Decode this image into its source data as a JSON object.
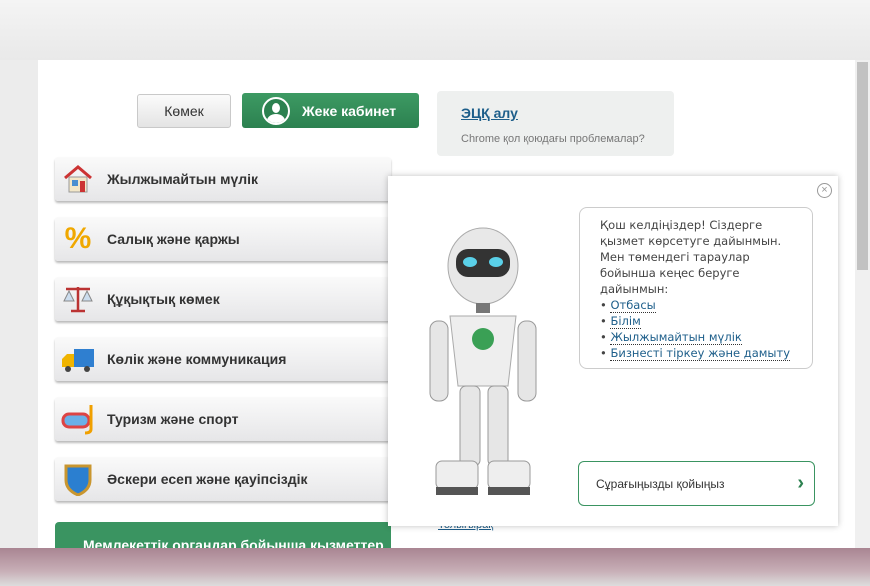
{
  "header": {
    "help_label": "Көмек",
    "cabinet_label": "Жеке кабинет"
  },
  "ecp": {
    "link": "ЭЦҚ алу",
    "subtitle": "Chrome қол қоюдағы проблемалар?"
  },
  "menu": [
    {
      "label": "Жылжымайтын мүлік",
      "icon": "house-icon"
    },
    {
      "label": "Салық және қаржы",
      "icon": "percent-icon"
    },
    {
      "label": "Құқықтық көмек",
      "icon": "scales-icon"
    },
    {
      "label": "Көлік және коммуникация",
      "icon": "truck-icon"
    },
    {
      "label": "Туризм және спорт",
      "icon": "diving-mask-icon"
    },
    {
      "label": "Әскери есеп және қауіпсіздік",
      "icon": "shield-icon"
    }
  ],
  "gov_services": "Мемлекеттік органдар бойынша қызметтер",
  "more_link": "Толығырақ",
  "assistant": {
    "greeting": "Қош келдіңіздер! Сіздерге қызмет көрсетуге дайынмын. Мен төмендегі тараулар бойынша кеңес беруге дайынмын:",
    "topics": [
      "Отбасы",
      "Білім",
      "Жылжымайтын мүлік",
      "Бизнесті тіркеу және дамыту"
    ],
    "ask_label": "Сұрағыңызды қойыңыз",
    "close": "×"
  },
  "colors": {
    "brand_green": "#2e8b57",
    "link": "#1d5e8a"
  }
}
